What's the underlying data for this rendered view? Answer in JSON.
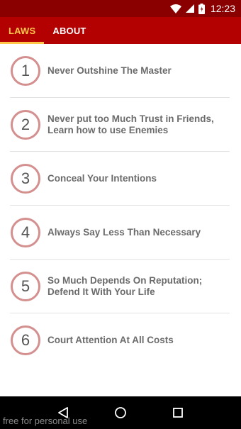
{
  "status_bar": {
    "time": "12:23",
    "icons": [
      "wifi-icon",
      "signal-icon",
      "battery-icon"
    ]
  },
  "tabs": [
    {
      "label": "LAWS",
      "active": true
    },
    {
      "label": "ABOUT",
      "active": false
    }
  ],
  "laws": [
    {
      "number": "1",
      "title": "Never Outshine The Master"
    },
    {
      "number": "2",
      "title": "Never put too Much Trust in Friends, Learn how to use Enemies"
    },
    {
      "number": "3",
      "title": "Conceal Your Intentions"
    },
    {
      "number": "4",
      "title": "Always Say Less Than Necessary"
    },
    {
      "number": "5",
      "title": "So Much Depends On Reputation; Defend It With Your Life"
    },
    {
      "number": "6",
      "title": "Court Attention At All Costs"
    }
  ],
  "nav_bar": {
    "icons": [
      "back-icon",
      "home-icon",
      "recents-icon"
    ]
  },
  "watermark": "free for personal use",
  "colors": {
    "status_bar": "#8a0000",
    "app_bar": "#b30000",
    "active_tab": "#ffc64a",
    "badge_border": "#d48f8f",
    "item_text": "#6b6b6b"
  }
}
